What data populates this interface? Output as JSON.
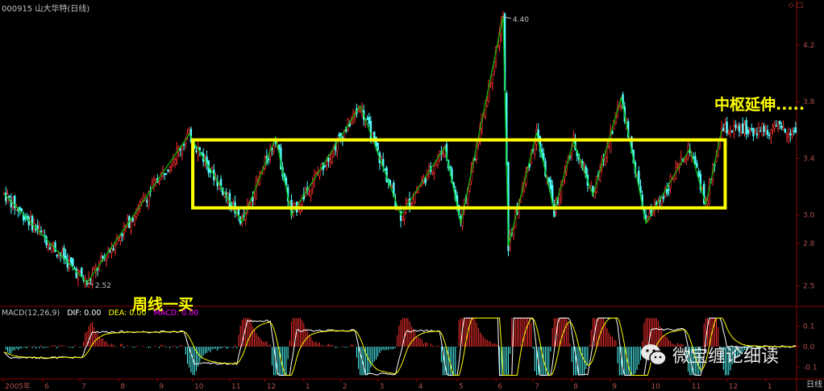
{
  "header": {
    "title": "000915 山大华特(日线)"
  },
  "annotations": {
    "pivot_extend": "中枢延伸.....",
    "weekly_buy": "周线一买"
  },
  "macd_legend": {
    "name": "MACD(12,26,9)",
    "dif": "DIF: 0.00",
    "dea": "DEA: 0.00",
    "macd": "MACD: 0.00"
  },
  "watermark": {
    "text": "微宝缠论细读",
    "icon": "wechat-icon"
  },
  "x_unit": "日线",
  "colors": {
    "up": "#ff3030",
    "down": "#50ffff",
    "stroke": "#00c000",
    "annotation": "#ffff00",
    "pivot_box": "#ffff00",
    "grid": "#8b0000",
    "dif": "#ffffff",
    "dea": "#ffff00",
    "macd": "#ff00ff"
  },
  "chart_data": {
    "type": "candlestick",
    "y_ticks": [
      "4.2",
      "3.8",
      "3.4",
      "3.0",
      "2.8",
      "2.5"
    ],
    "y_tick_values": [
      4.2,
      3.8,
      3.4,
      3.0,
      2.8,
      2.5
    ],
    "ylim": [
      2.4,
      4.45
    ],
    "macd_ticks": [
      "0.1",
      "0.0",
      "-0.1"
    ],
    "macd_tick_values": [
      0.1,
      0.0,
      -0.1
    ],
    "macd_ylim": [
      -0.15,
      0.15
    ],
    "x_ticks": [
      "2005年",
      "6",
      "7",
      "8",
      "9",
      "10",
      "11",
      "12",
      "1",
      "2",
      "3",
      "4",
      "5",
      "6",
      "7",
      "8",
      "9",
      "10",
      "11",
      "12",
      "1"
    ],
    "x_tick_day": [
      0,
      22,
      43,
      65,
      87,
      107,
      128,
      148,
      170,
      191,
      212,
      234,
      257,
      279,
      300,
      322,
      344,
      366,
      389,
      410,
      432
    ],
    "n_days": 450,
    "high_marker": {
      "label": "4.40",
      "day": 283,
      "value": 4.4
    },
    "low_marker": {
      "label": "2.52",
      "day": 47,
      "value": 2.52
    },
    "strokes": [
      {
        "day": 0,
        "value": 3.15
      },
      {
        "day": 47,
        "value": 2.52
      },
      {
        "day": 105,
        "value": 3.57
      },
      {
        "day": 135,
        "value": 2.95
      },
      {
        "day": 154,
        "value": 3.55
      },
      {
        "day": 163,
        "value": 3.0
      },
      {
        "day": 202,
        "value": 3.77
      },
      {
        "day": 225,
        "value": 3.0
      },
      {
        "day": 250,
        "value": 3.48
      },
      {
        "day": 259,
        "value": 2.94
      },
      {
        "day": 283,
        "value": 4.4
      },
      {
        "day": 286,
        "value": 2.78
      },
      {
        "day": 302,
        "value": 3.58
      },
      {
        "day": 312,
        "value": 3.03
      },
      {
        "day": 323,
        "value": 3.52
      },
      {
        "day": 334,
        "value": 3.14
      },
      {
        "day": 350,
        "value": 3.83
      },
      {
        "day": 364,
        "value": 2.94
      },
      {
        "day": 389,
        "value": 3.47
      },
      {
        "day": 398,
        "value": 3.07
      },
      {
        "day": 407,
        "value": 3.6
      }
    ],
    "pivot_box": {
      "day_start": 107,
      "day_end": 409,
      "high": 3.53,
      "low": 3.05
    }
  }
}
